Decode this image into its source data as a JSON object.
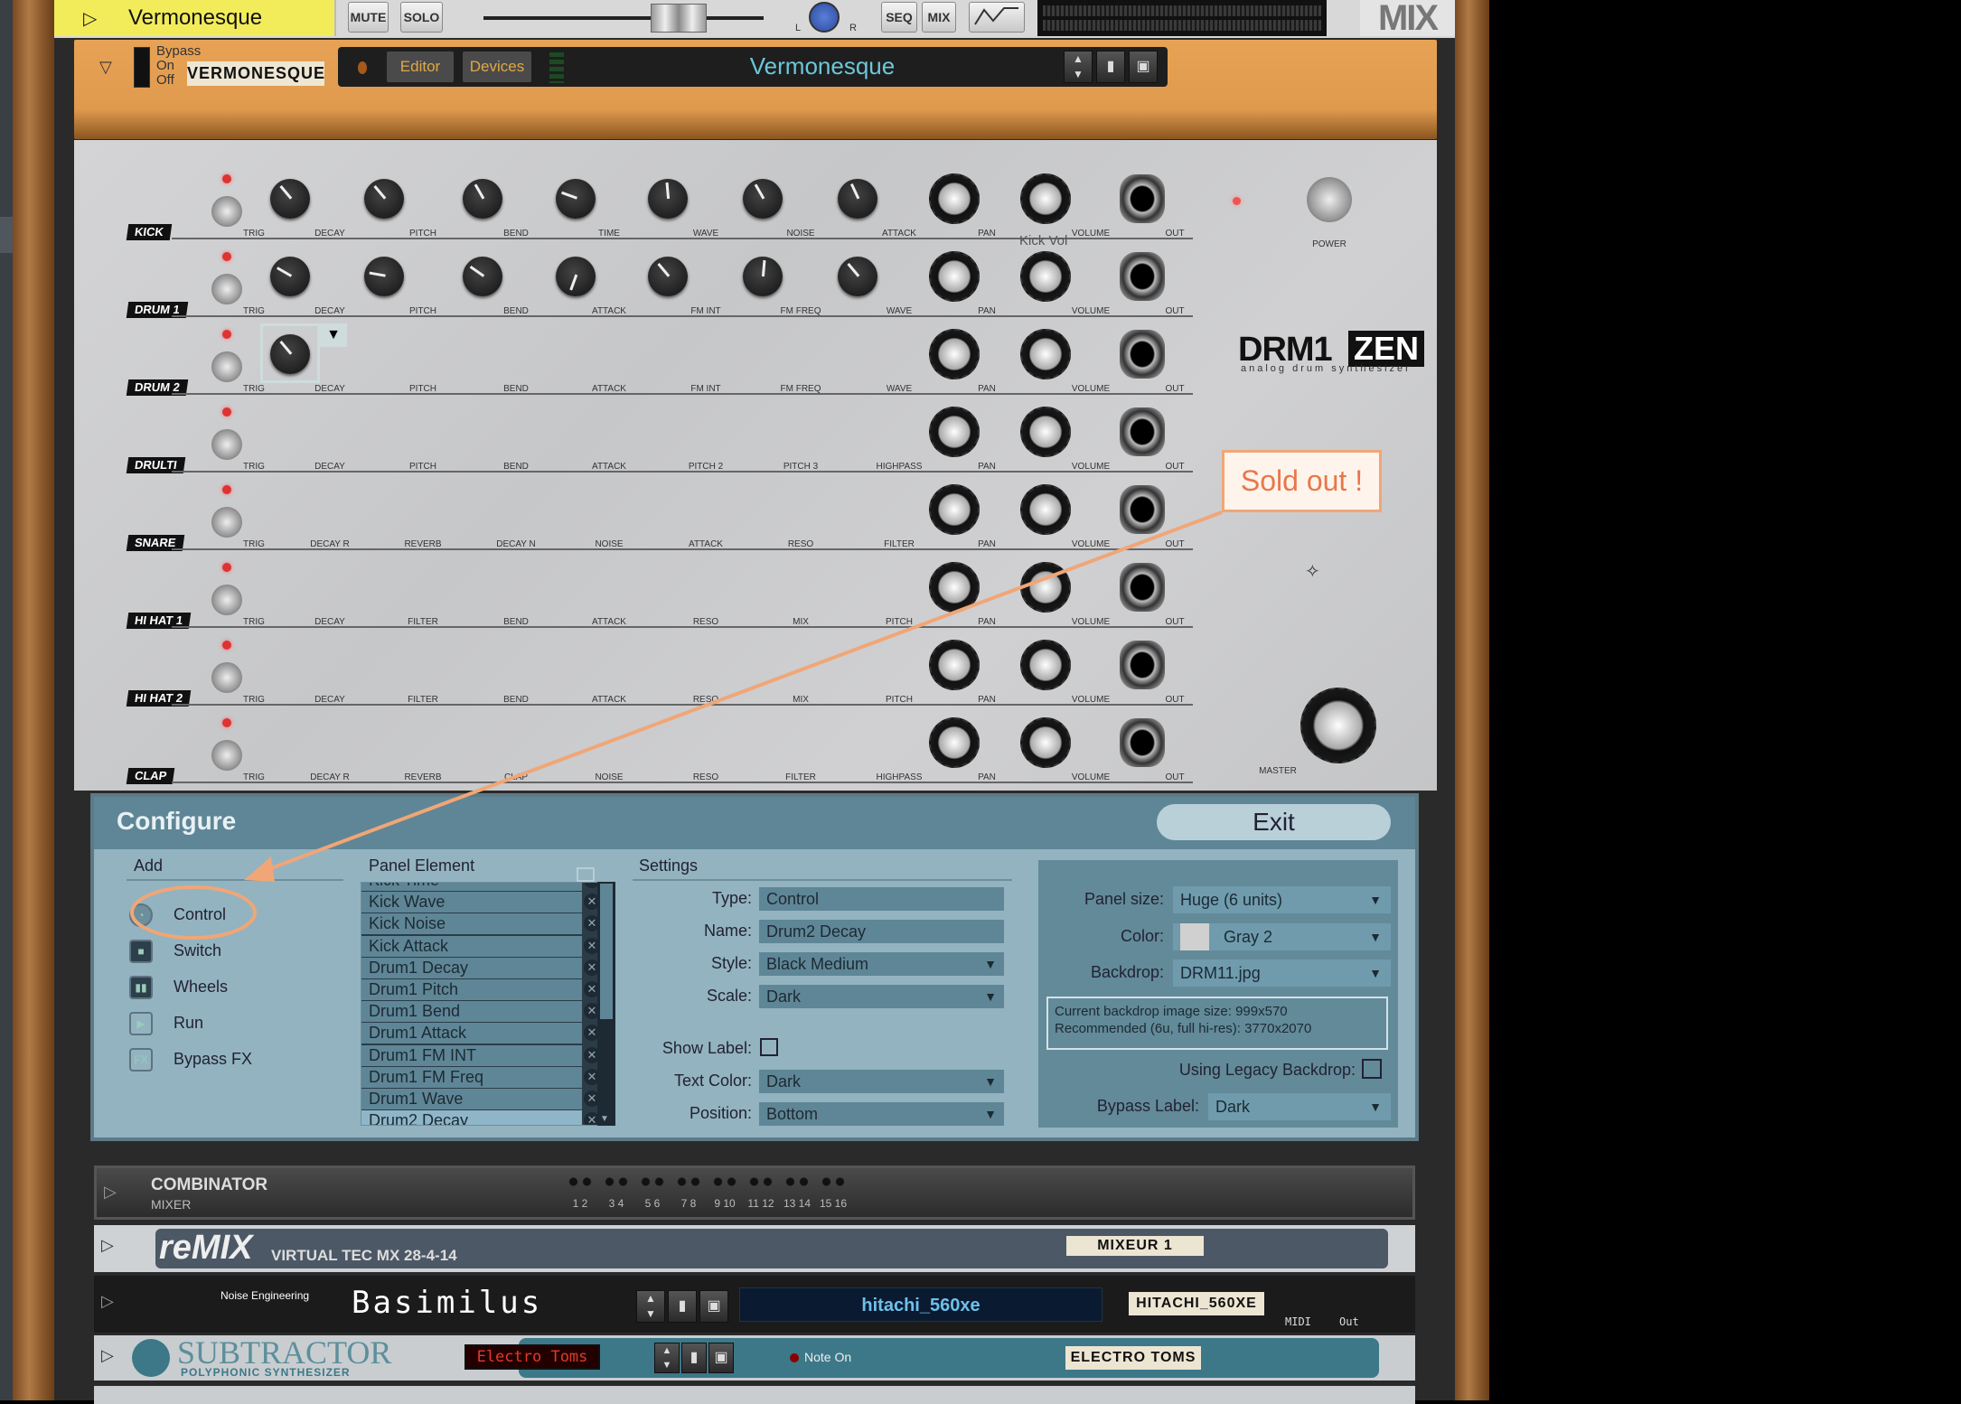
{
  "mixer_strip": {
    "track_name": "Vermonesque",
    "mute": "MUTE",
    "solo": "SOLO",
    "pan_l": "L",
    "pan_r": "R",
    "seq": "SEQ",
    "mix": "MIX",
    "mix_label": "MIX"
  },
  "device_header": {
    "bypass": "Bypass",
    "on": "On",
    "off": "Off",
    "tape_label": "VERMONESQUE",
    "editor": "Editor",
    "devices": "Devices",
    "patch_name": "Vermonesque"
  },
  "panel": {
    "logo": "DRM1",
    "logo_badge": "ZEN",
    "logo_sub": "analog drum synthesizer",
    "power": "POWER",
    "master": "MASTER",
    "tooltip": "Kick Vol",
    "rows": [
      {
        "name": "KICK",
        "knobs": 7,
        "params": [
          "TRIG",
          "DECAY",
          "PITCH",
          "BEND",
          "TIME",
          "WAVE",
          "NOISE",
          "ATTACK",
          "PAN",
          "VOLUME",
          "OUT"
        ]
      },
      {
        "name": "DRUM 1",
        "knobs": 7,
        "params": [
          "TRIG",
          "DECAY",
          "PITCH",
          "BEND",
          "ATTACK",
          "FM INT",
          "FM FREQ",
          "WAVE",
          "PAN",
          "VOLUME",
          "OUT"
        ]
      },
      {
        "name": "DRUM 2",
        "knobs": 1,
        "params": [
          "TRIG",
          "DECAY",
          "PITCH",
          "BEND",
          "ATTACK",
          "FM INT",
          "FM FREQ",
          "WAVE",
          "PAN",
          "VOLUME",
          "OUT"
        ]
      },
      {
        "name": "DRULTI",
        "knobs": 0,
        "params": [
          "TRIG",
          "DECAY",
          "PITCH",
          "BEND",
          "ATTACK",
          "PITCH 2",
          "PITCH 3",
          "HIGHPASS",
          "PAN",
          "VOLUME",
          "OUT"
        ]
      },
      {
        "name": "SNARE",
        "knobs": 0,
        "params": [
          "TRIG",
          "DECAY R",
          "REVERB",
          "DECAY N",
          "NOISE",
          "ATTACK",
          "RESO",
          "FILTER",
          "PAN",
          "VOLUME",
          "OUT"
        ]
      },
      {
        "name": "HI HAT 1",
        "knobs": 0,
        "params": [
          "TRIG",
          "DECAY",
          "FILTER",
          "BEND",
          "ATTACK",
          "RESO",
          "MIX",
          "PITCH",
          "PAN",
          "VOLUME",
          "OUT"
        ]
      },
      {
        "name": "HI HAT 2",
        "knobs": 0,
        "params": [
          "TRIG",
          "DECAY",
          "FILTER",
          "BEND",
          "ATTACK",
          "RESO",
          "MIX",
          "PITCH",
          "PAN",
          "VOLUME",
          "OUT"
        ]
      },
      {
        "name": "CLAP",
        "knobs": 0,
        "params": [
          "TRIG",
          "DECAY R",
          "REVERB",
          "CLAP",
          "NOISE",
          "RESO",
          "FILTER",
          "HIGHPASS",
          "PAN",
          "VOLUME",
          "OUT"
        ]
      }
    ]
  },
  "configure": {
    "title": "Configure",
    "exit": "Exit",
    "add": {
      "header": "Add",
      "items": [
        {
          "label": "Control",
          "icon": "knob-icon"
        },
        {
          "label": "Switch",
          "icon": "switch-icon"
        },
        {
          "label": "Wheels",
          "icon": "wheels-icon"
        },
        {
          "label": "Run",
          "icon": "play-icon"
        },
        {
          "label": "Bypass FX",
          "icon": "fx-icon"
        }
      ]
    },
    "panel_element": {
      "header": "Panel Element",
      "items": [
        "Kick Time",
        "Kick Wave",
        "Kick Noise",
        "Kick Attack",
        "Drum1 Decay",
        "Drum1 Pitch",
        "Drum1 Bend",
        "Drum1 Attack",
        "Drum1 FM INT",
        "Drum1 FM Freq",
        "Drum1 Wave",
        "Drum2 Decay"
      ],
      "selected": "Drum2 Decay"
    },
    "settings": {
      "header": "Settings",
      "type_label": "Type:",
      "type": "Control",
      "name_label": "Name:",
      "name": "Drum2 Decay",
      "style_label": "Style:",
      "style": "Black Medium",
      "scale_label": "Scale:",
      "scale": "Dark",
      "show_label_label": "Show Label:",
      "show_label": false,
      "text_color_label": "Text Color:",
      "text_color": "Dark",
      "position_label": "Position:",
      "position": "Bottom"
    },
    "device": {
      "panel_size_label": "Panel size:",
      "panel_size": "Huge (6 units)",
      "color_label": "Color:",
      "color": "Gray 2",
      "color_swatch": "#d0d0d0",
      "backdrop_label": "Backdrop:",
      "backdrop": "DRM11.jpg",
      "info_line1": "Current backdrop image size: 999x570",
      "info_line2": "Recommended (6u, full hi-res): 3770x2070",
      "legacy_label": "Using Legacy Backdrop:",
      "legacy": false,
      "bypass_label_label": "Bypass Label:",
      "bypass_label": "Dark"
    }
  },
  "annotation": {
    "text": "Sold out !",
    "color": "#f0a676"
  },
  "rack": {
    "combinator": {
      "title": "COMBINATOR",
      "subtitle": "MIXER",
      "channels": [
        "1 2",
        "3 4",
        "5 6",
        "7 8",
        "9 10",
        "11 12",
        "13 14",
        "15 16"
      ]
    },
    "remix": {
      "logo": "reMIX",
      "model": "VIRTUAL TEC MX 28-4-14",
      "tape": "MIXEUR 1"
    },
    "basimilus": {
      "brand": "Noise Engineering",
      "name": "Basimilus",
      "patch": "hitachi_560xe",
      "tape": "HITACHI_560XE",
      "midi": "MIDI",
      "out": "Out"
    },
    "subtractor": {
      "logo": "SUBTRACTOR",
      "sub": "POLYPHONIC SYNTHESIZER",
      "patch": "Electro Toms",
      "note_on": "Note On",
      "tape": "ELECTRO TOMS"
    }
  }
}
